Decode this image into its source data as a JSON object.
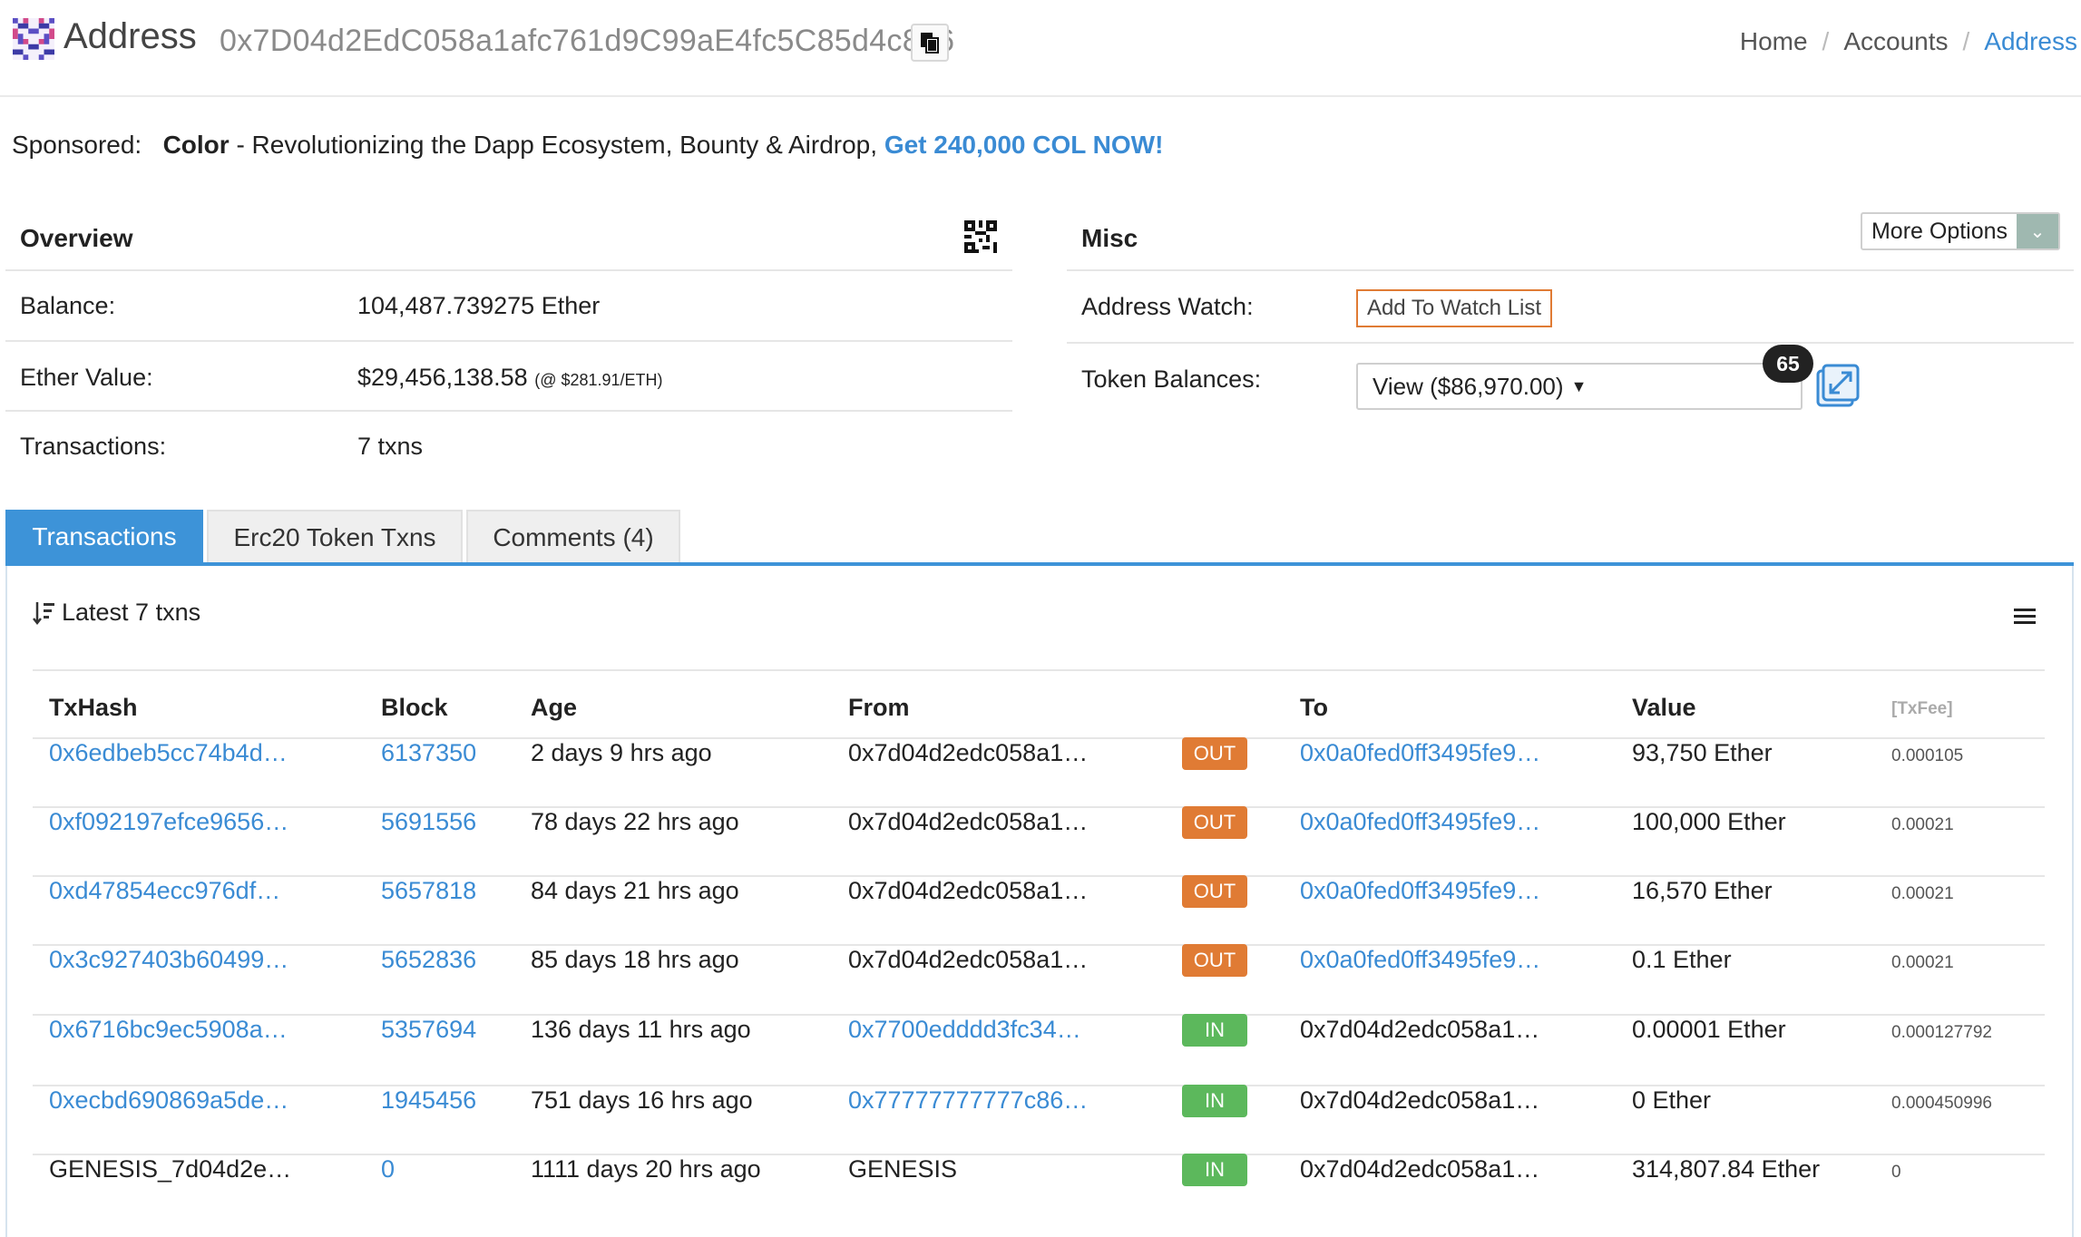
{
  "header": {
    "title": "Address",
    "address": "0x7D04d2EdC058a1afc761d9C99aE4fc5C85d4c8a6",
    "breadcrumbs": [
      "Home",
      "Accounts",
      "Address"
    ]
  },
  "sponsor": {
    "prefix": "Sponsored:",
    "brand": "Color",
    "text": " - Revolutionizing the Dapp Ecosystem, Bounty & Airdrop, ",
    "cta": "Get 240,000 COL NOW!"
  },
  "overview": {
    "title": "Overview",
    "rows": [
      {
        "label": "Balance:",
        "value": "104,487.739275 Ether"
      },
      {
        "label": "Ether Value:",
        "value": "$29,456,138.58",
        "note": "(@ $281.91/ETH)"
      },
      {
        "label": "Transactions:",
        "value": "7 txns"
      }
    ]
  },
  "misc": {
    "title": "Misc",
    "more_options": "More Options",
    "watch_label": "Address Watch:",
    "watch_button": "Add To Watch List",
    "token_label": "Token Balances:",
    "token_select": "View ($86,970.00)",
    "token_count": "65"
  },
  "tabs": [
    "Transactions",
    "Erc20 Token Txns",
    "Comments (4)"
  ],
  "txlist": {
    "summary": "Latest 7 txns",
    "columns": {
      "hash": "TxHash",
      "block": "Block",
      "age": "Age",
      "from": "From",
      "to": "To",
      "value": "Value",
      "fee": "[TxFee]"
    },
    "rows": [
      {
        "hash": "0x6edbeb5cc74b4d…",
        "hash_link": true,
        "block": "6137350",
        "age": "2 days 9 hrs ago",
        "from": "0x7d04d2edc058a1…",
        "from_link": false,
        "dir": "OUT",
        "to": "0x0a0fed0ff3495fe9…",
        "to_link": true,
        "value": "93,750 Ether",
        "fee": "0.000105"
      },
      {
        "hash": "0xf092197efce9656…",
        "hash_link": true,
        "block": "5691556",
        "age": "78 days 22 hrs ago",
        "from": "0x7d04d2edc058a1…",
        "from_link": false,
        "dir": "OUT",
        "to": "0x0a0fed0ff3495fe9…",
        "to_link": true,
        "value": "100,000 Ether",
        "fee": "0.00021"
      },
      {
        "hash": "0xd47854ecc976df…",
        "hash_link": true,
        "block": "5657818",
        "age": "84 days 21 hrs ago",
        "from": "0x7d04d2edc058a1…",
        "from_link": false,
        "dir": "OUT",
        "to": "0x0a0fed0ff3495fe9…",
        "to_link": true,
        "value": "16,570 Ether",
        "fee": "0.00021"
      },
      {
        "hash": "0x3c927403b60499…",
        "hash_link": true,
        "block": "5652836",
        "age": "85 days 18 hrs ago",
        "from": "0x7d04d2edc058a1…",
        "from_link": false,
        "dir": "OUT",
        "to": "0x0a0fed0ff3495fe9…",
        "to_link": true,
        "value": "0.1 Ether",
        "fee": "0.00021"
      },
      {
        "hash": "0x6716bc9ec5908a…",
        "hash_link": true,
        "block": "5357694",
        "age": "136 days 11 hrs ago",
        "from": "0x7700edddd3fc34…",
        "from_link": true,
        "dir": "IN",
        "to": "0x7d04d2edc058a1…",
        "to_link": false,
        "value": "0.00001 Ether",
        "fee": "0.000127792"
      },
      {
        "hash": "0xecbd690869a5de…",
        "hash_link": true,
        "block": "1945456",
        "age": "751 days 16 hrs ago",
        "from": "0x77777777777c86…",
        "from_link": true,
        "dir": "IN",
        "to": "0x7d04d2edc058a1…",
        "to_link": false,
        "value": "0 Ether",
        "fee": "0.000450996"
      },
      {
        "hash": "GENESIS_7d04d2e…",
        "hash_link": false,
        "block": "0",
        "age": "1111 days 20 hrs ago",
        "from": "GENESIS",
        "from_link": false,
        "dir": "IN",
        "to": "0x7d04d2edc058a1…",
        "to_link": false,
        "value": "314,807.84 Ether",
        "fee": "0"
      }
    ]
  },
  "colors": {
    "link": "#3a8bd4",
    "out": "#e07b34",
    "in": "#5cb85c",
    "tab_active": "#3d93d8"
  }
}
